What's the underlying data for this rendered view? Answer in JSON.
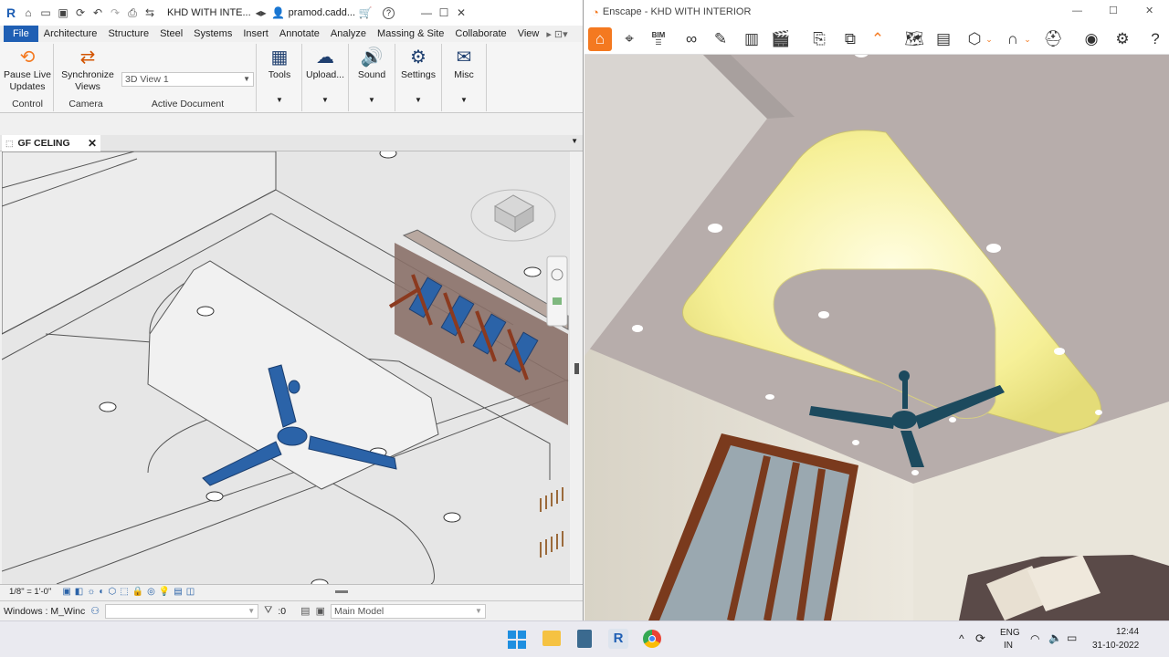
{
  "revit": {
    "qat": {
      "logo": "R",
      "project_title": "KHD WITH INTE...",
      "user": "pramod.cadd...",
      "help": "?"
    },
    "tabs": [
      "File",
      "Architecture",
      "Structure",
      "Steel",
      "Systems",
      "Insert",
      "Annotate",
      "Analyze",
      "Massing & Site",
      "Collaborate",
      "View"
    ],
    "ribbon": {
      "pause_label": "Pause Live Updates",
      "sync_label": "Synchronize Views",
      "view_select": "3D View 1",
      "buttons": {
        "tools": "Tools",
        "upload": "Upload...",
        "sound": "Sound",
        "settings": "Settings",
        "misc": "Misc"
      },
      "panels": {
        "control": "Control",
        "camera": "Camera",
        "active_document": "Active Document"
      }
    },
    "view_tab": {
      "title": "GF CELING"
    },
    "view_controls": {
      "scale": "1/8\" = 1'-0\""
    },
    "status": {
      "windows": "Windows : M_Winc",
      "count": ":0",
      "model": "Main Model"
    }
  },
  "enscape": {
    "title": "Enscape - KHD WITH INTERIOR",
    "icons": [
      "home-icon",
      "location-icon",
      "bim-icon",
      "binoculars-icon",
      "pen-icon",
      "buildings-icon",
      "clapper-icon",
      "render-export-icon",
      "batch-render-icon",
      "collapse-icon",
      "map-icon",
      "panorama-icon",
      "cube-icon",
      "archway-icon",
      "vr-headset-icon",
      "eye-icon",
      "settings-icon",
      "help-icon"
    ],
    "bim_label": "BIM"
  },
  "taskbar": {
    "lang_top": "ENG",
    "lang_bottom": "IN",
    "time": "12:44",
    "date": "31-10-2022"
  },
  "colors": {
    "revit_blue": "#1f5fb4",
    "enscape_orange": "#f47920",
    "fan_blue": "#2b63a8"
  }
}
